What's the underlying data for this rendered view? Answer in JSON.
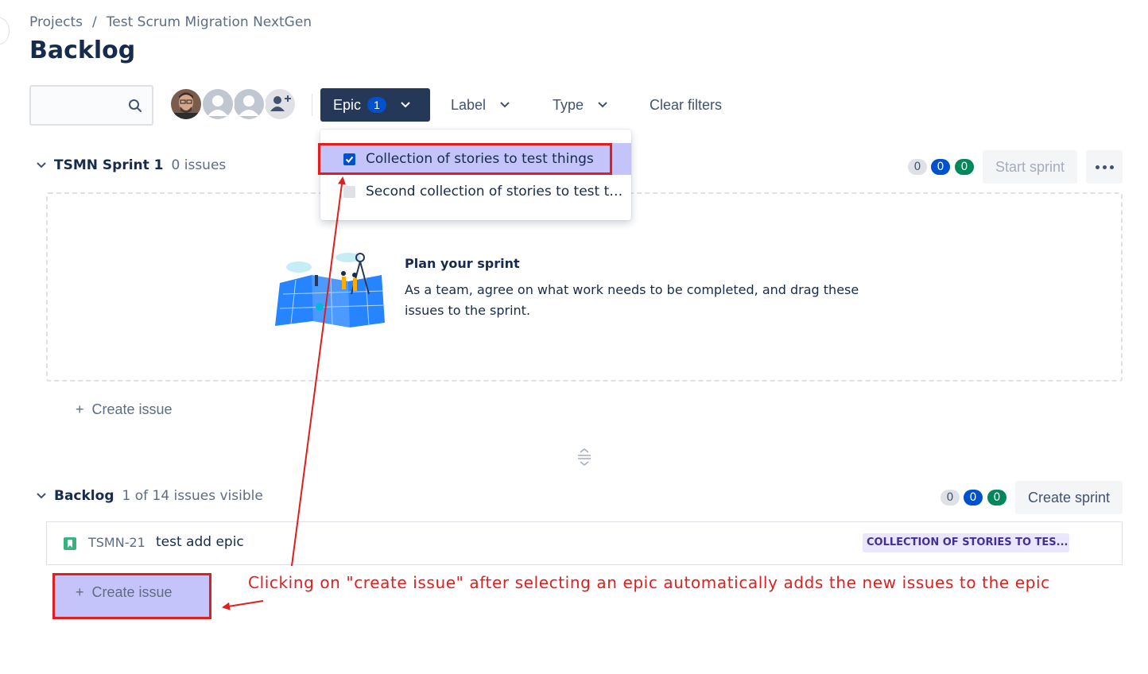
{
  "breadcrumb": {
    "items": [
      "Projects",
      "Test Scrum Migration NextGen"
    ],
    "separator": "/"
  },
  "page_title": "Backlog",
  "toolbar": {
    "search_placeholder": "",
    "epic_filter": {
      "label": "Epic",
      "count": "1"
    },
    "label_filter": "Label",
    "type_filter": "Type",
    "clear_filters": "Clear filters"
  },
  "epic_dropdown": {
    "options": [
      {
        "label": "Collection of stories to test things",
        "checked": true
      },
      {
        "label": "Second collection of stories to test t…",
        "checked": false
      }
    ]
  },
  "sprint": {
    "name": "TSMN Sprint 1",
    "issue_count": "0 issues",
    "counts": [
      "0",
      "0",
      "0"
    ],
    "start_button": "Start sprint",
    "empty_title": "Plan your sprint",
    "empty_text": "As a team, agree on what work needs to be completed, and drag these issues to the sprint.",
    "create_issue": "Create issue"
  },
  "backlog": {
    "name": "Backlog",
    "visible_text": "1 of 14 issues visible",
    "counts": [
      "0",
      "0",
      "0"
    ],
    "create_sprint": "Create sprint",
    "issues": [
      {
        "key": "TSMN-21",
        "summary": "test add epic",
        "epic": "COLLECTION OF STORIES TO TES..."
      }
    ],
    "create_issue": "Create issue"
  },
  "annotation": "Clicking on \"create issue\" after selecting an epic automatically adds the new issues to the epic",
  "colors": {
    "annotation": "#e01e1e",
    "highlight": "#c4c4fb",
    "primary": "#0052cc",
    "success": "#00875a",
    "epic_button": "#253858"
  }
}
